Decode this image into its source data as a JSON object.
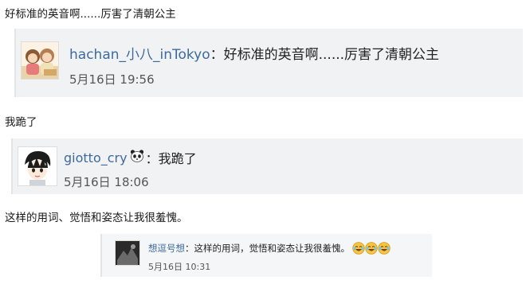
{
  "posts": [
    {
      "text": "好标准的英音啊......厉害了清朝公主",
      "quote": {
        "username": "hachan_小八_inTokyo",
        "colon": "：",
        "text": "好标准的英音啊......厉害了清朝公主",
        "time": "5月16日 19:56"
      }
    },
    {
      "text": "我跪了",
      "quote": {
        "username": "giotto_cry",
        "username_emoji": "panda-emoji",
        "colon": "：",
        "text": "我跪了",
        "time": "5月16日 18:06"
      }
    },
    {
      "text": "这样的用词、觉悟和姿态让我很羞愧。",
      "quote": {
        "username": "想逗号想",
        "colon": "：",
        "text": "这样的用词，觉悟和姿态让我很羞愧。",
        "emojis": [
          "laugh-cry-emoji",
          "laugh-cry-emoji",
          "laugh-cry-emoji"
        ],
        "time": "5月16日 10:31"
      }
    }
  ]
}
